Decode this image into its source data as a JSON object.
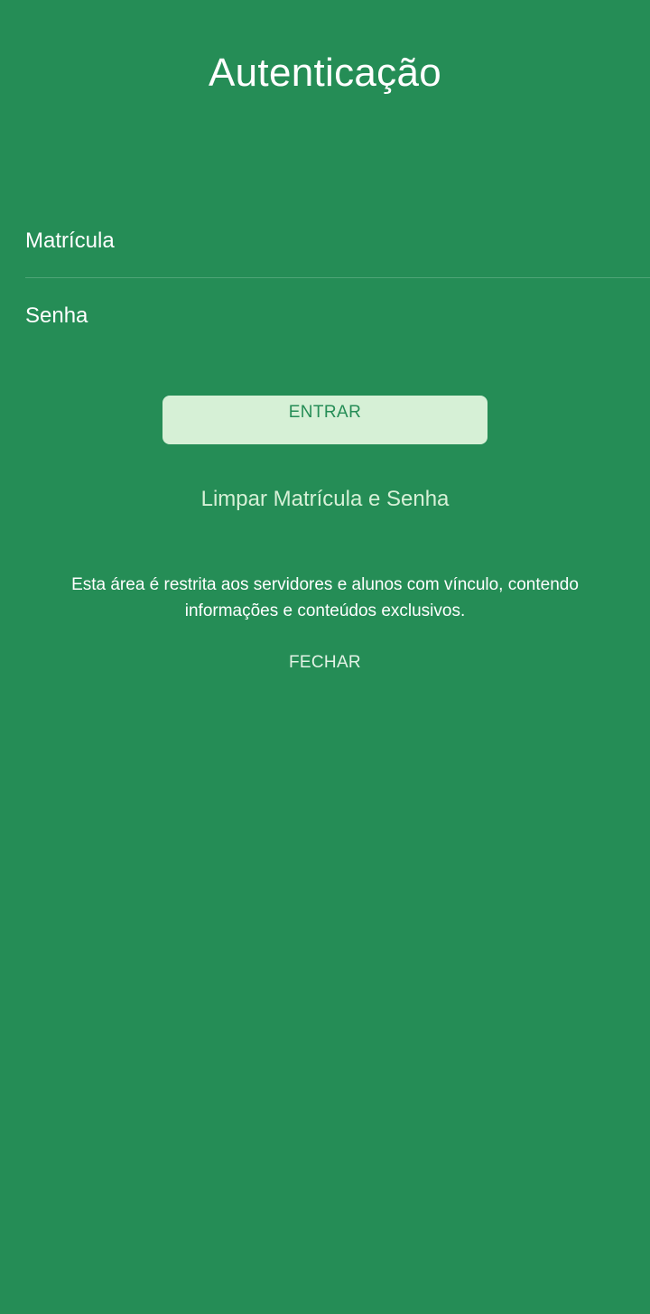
{
  "page": {
    "title": "Autenticação"
  },
  "form": {
    "matricula": {
      "placeholder": "Matrícula",
      "value": ""
    },
    "senha": {
      "placeholder": "Senha",
      "value": ""
    }
  },
  "actions": {
    "login_label": "ENTRAR",
    "clear_label": "Limpar Matrícula e Senha",
    "close_label": "FECHAR"
  },
  "notice": {
    "text": "Esta área é restrita aos servidores e alunos com vínculo, contendo informações e conteúdos exclusivos."
  },
  "colors": {
    "background": "#258d56",
    "button_fill": "#d6f0d6",
    "button_text": "#258d56"
  }
}
